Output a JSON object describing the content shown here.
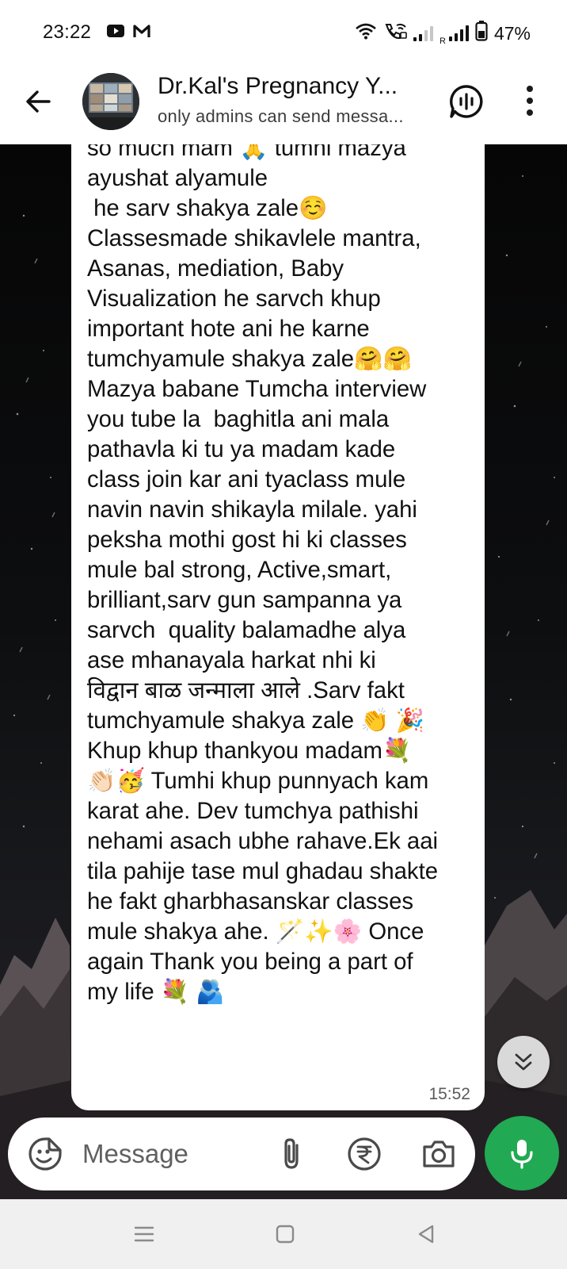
{
  "status_bar": {
    "time": "23:22",
    "roaming": "R",
    "battery": "47%",
    "notification_icons": [
      "youtube-icon",
      "gmail-icon"
    ]
  },
  "header": {
    "title": "Dr.Kal's Pregnancy Y...",
    "subtitle": "only admins can send messa..."
  },
  "message": {
    "text": "so much mam 🙏 tumhi mazya\nayushat alyamule\n he sarv shakya zale☺️\nClassesmade shikavlele mantra,\nAsanas, mediation, Baby\nVisualization he sarvch khup\nimportant hote ani he karne\ntumchyamule shakya zale🤗🤗\nMazya babane Tumcha interview\nyou tube la  baghitla ani mala\npathavla ki tu ya madam kade\nclass join kar ani tyaclass mule\nnavin navin shikayla milale. yahi\npeksha mothi gost hi ki classes\nmule bal strong, Active,smart,\nbrilliant,sarv gun sampanna ya\nsarvch  quality balamadhe alya\nase mhanayala harkat nhi ki\nविद्वान बाळ जन्माला आले .Sarv fakt\ntumchyamule shakya zale 👏 🎉\nKhup khup thankyou madam💐\n👏🏻🥳 Tumhi khup punnyach kam\nkarat ahe. Dev tumchya pathishi\nnehami asach ubhe rahave.Ek aai\ntila pahije tase mul ghadau shakte\nhe fakt gharbhasanskar classes\nmule shakya ahe. 🪄✨🌸 Once\nagain Thank you being a part of\nmy life 💐 🫂",
    "time": "15:52"
  },
  "composer": {
    "placeholder": "Message"
  },
  "colors": {
    "mic_button": "#22a954",
    "bubble": "#ffffff",
    "chat_background": "#0b0b0d"
  }
}
